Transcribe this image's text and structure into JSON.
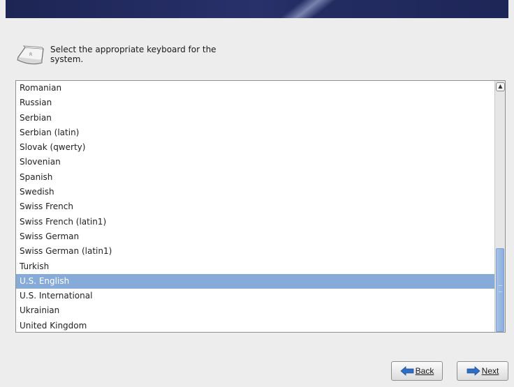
{
  "header": {
    "text": "Select the appropriate keyboard for the system."
  },
  "keyboards": {
    "items": [
      "Romanian",
      "Russian",
      "Serbian",
      "Serbian (latin)",
      "Slovak (qwerty)",
      "Slovenian",
      "Spanish",
      "Swedish",
      "Swiss French",
      "Swiss French (latin1)",
      "Swiss German",
      "Swiss German (latin1)",
      "Turkish",
      "U.S. English",
      "U.S. International",
      "Ukrainian",
      "United Kingdom"
    ],
    "selected": "U.S. English"
  },
  "buttons": {
    "back_label": "Back",
    "next_label": "Next"
  },
  "icons": {
    "header": "keyboard-icon",
    "back": "arrow-left-icon",
    "next": "arrow-right-icon",
    "scroll_up": "scroll-up-arrow-icon"
  },
  "colors": {
    "selection": "#86abd9",
    "banner": "#1d2554",
    "arrow": "#2f6cc4"
  }
}
